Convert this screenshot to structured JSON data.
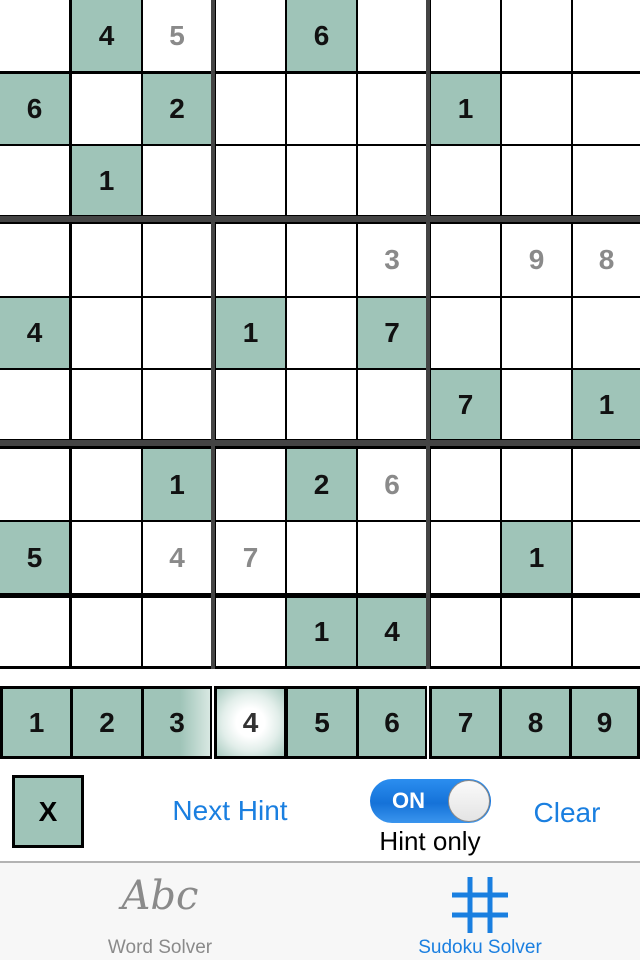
{
  "grid": {
    "rows": [
      [
        {
          "v": "",
          "t": "empty"
        },
        {
          "v": "4",
          "t": "given"
        },
        {
          "v": "5",
          "t": "hint"
        },
        {
          "v": "",
          "t": "empty"
        },
        {
          "v": "6",
          "t": "given"
        },
        {
          "v": "",
          "t": "empty"
        },
        {
          "v": "",
          "t": "empty"
        },
        {
          "v": "",
          "t": "empty"
        },
        {
          "v": "",
          "t": "empty"
        }
      ],
      [
        {
          "v": "6",
          "t": "given"
        },
        {
          "v": "",
          "t": "empty"
        },
        {
          "v": "2",
          "t": "given"
        },
        {
          "v": "",
          "t": "empty"
        },
        {
          "v": "",
          "t": "empty"
        },
        {
          "v": "",
          "t": "empty"
        },
        {
          "v": "1",
          "t": "given"
        },
        {
          "v": "",
          "t": "empty"
        },
        {
          "v": "",
          "t": "empty"
        }
      ],
      [
        {
          "v": "",
          "t": "empty"
        },
        {
          "v": "1",
          "t": "given"
        },
        {
          "v": "",
          "t": "empty"
        },
        {
          "v": "",
          "t": "empty"
        },
        {
          "v": "",
          "t": "empty"
        },
        {
          "v": "",
          "t": "empty"
        },
        {
          "v": "",
          "t": "empty"
        },
        {
          "v": "",
          "t": "empty"
        },
        {
          "v": "",
          "t": "empty"
        }
      ],
      [
        {
          "v": "",
          "t": "empty"
        },
        {
          "v": "",
          "t": "empty"
        },
        {
          "v": "",
          "t": "empty"
        },
        {
          "v": "",
          "t": "empty"
        },
        {
          "v": "",
          "t": "empty"
        },
        {
          "v": "3",
          "t": "hint"
        },
        {
          "v": "",
          "t": "empty"
        },
        {
          "v": "9",
          "t": "hint"
        },
        {
          "v": "8",
          "t": "hint"
        }
      ],
      [
        {
          "v": "4",
          "t": "given"
        },
        {
          "v": "",
          "t": "empty"
        },
        {
          "v": "",
          "t": "empty"
        },
        {
          "v": "1",
          "t": "given"
        },
        {
          "v": "",
          "t": "empty"
        },
        {
          "v": "7",
          "t": "given"
        },
        {
          "v": "",
          "t": "empty"
        },
        {
          "v": "",
          "t": "empty"
        },
        {
          "v": "",
          "t": "empty"
        }
      ],
      [
        {
          "v": "",
          "t": "empty"
        },
        {
          "v": "",
          "t": "empty"
        },
        {
          "v": "",
          "t": "empty"
        },
        {
          "v": "",
          "t": "empty"
        },
        {
          "v": "",
          "t": "empty"
        },
        {
          "v": "",
          "t": "empty"
        },
        {
          "v": "7",
          "t": "given"
        },
        {
          "v": "",
          "t": "empty"
        },
        {
          "v": "1",
          "t": "given"
        }
      ],
      [
        {
          "v": "",
          "t": "empty"
        },
        {
          "v": "",
          "t": "empty"
        },
        {
          "v": "1",
          "t": "given"
        },
        {
          "v": "",
          "t": "empty"
        },
        {
          "v": "2",
          "t": "given"
        },
        {
          "v": "6",
          "t": "hint"
        },
        {
          "v": "",
          "t": "empty"
        },
        {
          "v": "",
          "t": "empty"
        },
        {
          "v": "",
          "t": "empty"
        }
      ],
      [
        {
          "v": "5",
          "t": "given"
        },
        {
          "v": "",
          "t": "empty"
        },
        {
          "v": "4",
          "t": "hint"
        },
        {
          "v": "7",
          "t": "hint"
        },
        {
          "v": "",
          "t": "empty"
        },
        {
          "v": "",
          "t": "empty"
        },
        {
          "v": "",
          "t": "empty"
        },
        {
          "v": "1",
          "t": "given"
        },
        {
          "v": "",
          "t": "empty"
        }
      ],
      [
        {
          "v": "",
          "t": "empty"
        },
        {
          "v": "",
          "t": "empty"
        },
        {
          "v": "",
          "t": "empty"
        },
        {
          "v": "",
          "t": "empty"
        },
        {
          "v": "1",
          "t": "given"
        },
        {
          "v": "4",
          "t": "given"
        },
        {
          "v": "",
          "t": "empty"
        },
        {
          "v": "",
          "t": "empty"
        },
        {
          "v": "",
          "t": "empty"
        }
      ]
    ]
  },
  "number_pad": {
    "keys": [
      "1",
      "2",
      "3",
      "4",
      "5",
      "6",
      "7",
      "8",
      "9"
    ],
    "selected": "4"
  },
  "controls": {
    "erase_label": "X",
    "next_hint_label": "Next Hint",
    "toggle_state_label": "ON",
    "toggle_on": true,
    "toggle_caption": "Hint only",
    "clear_label": "Clear"
  },
  "tabbar": {
    "tabs": [
      {
        "label": "Word Solver",
        "icon": "abc-icon",
        "icon_text": "Abc",
        "active": false
      },
      {
        "label": "Sudoku Solver",
        "icon": "hash-grid-icon",
        "active": true
      }
    ]
  },
  "colors": {
    "given_cell": "#9fc4b8",
    "hint_text": "#8a8a8a",
    "accent": "#1a7fe0",
    "box_line": "#444444"
  }
}
